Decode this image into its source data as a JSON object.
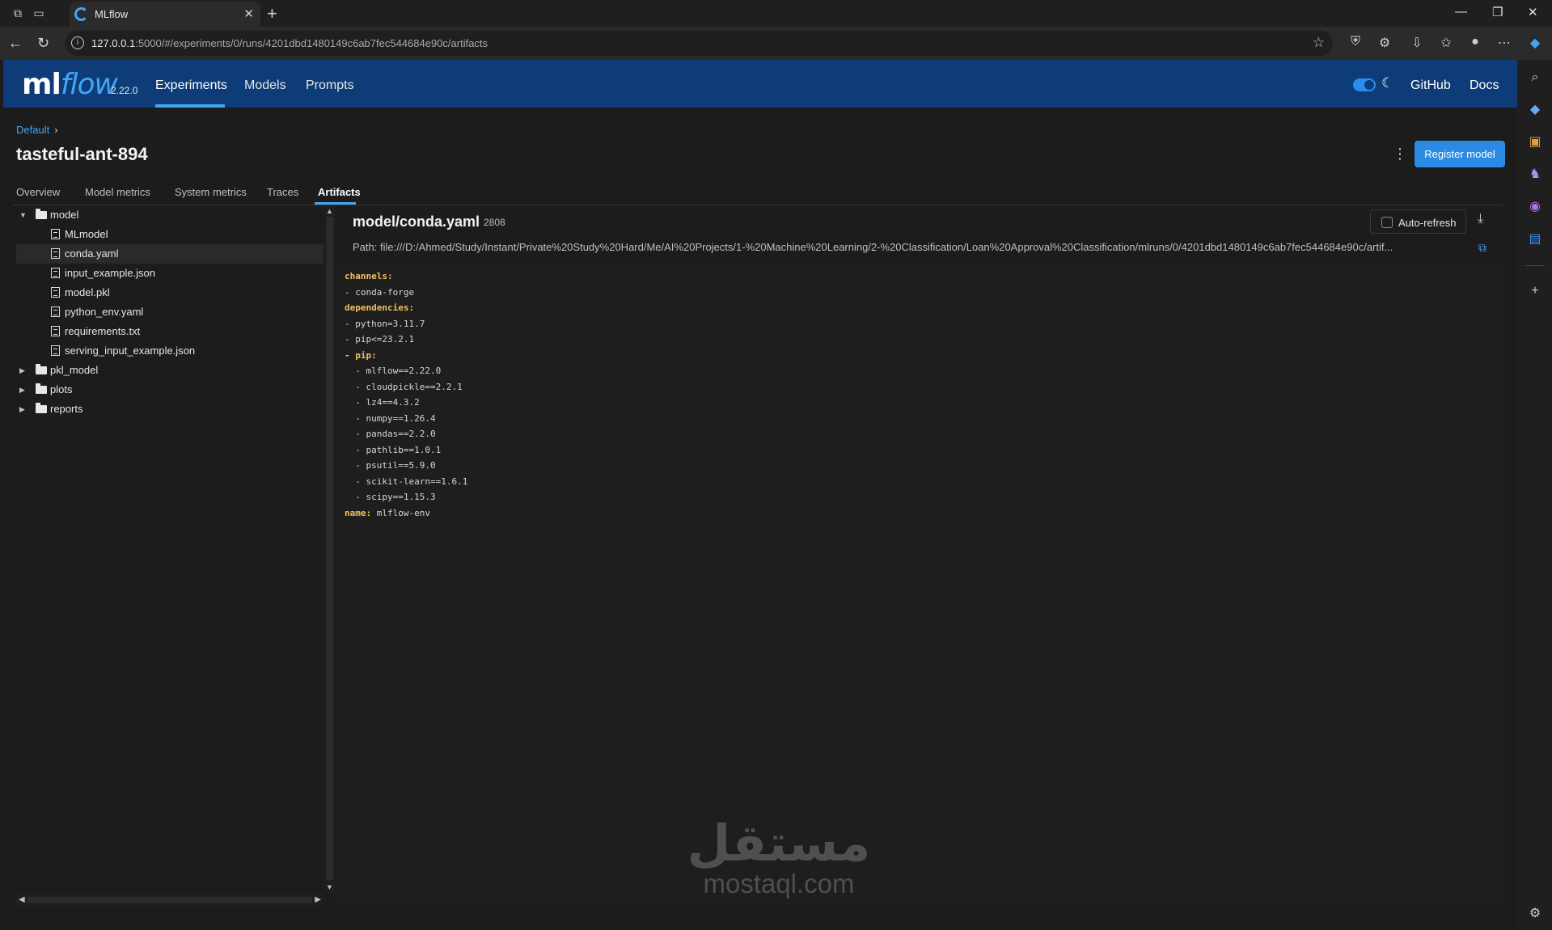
{
  "browser": {
    "tab_title": "MLflow",
    "url_host": "127.0.0.1",
    "url_rest": ":5000/#/experiments/0/runs/4201dbd1480149c6ab7fec544684e90c/artifacts",
    "newtab_label": "+",
    "icons": [
      "workspaces-icon",
      "tab-actions-icon",
      "back-icon",
      "refresh-icon",
      "star-icon",
      "shield-extension-icon",
      "extensions-icon",
      "downloads-icon",
      "favorites-icon",
      "profile-avatar",
      "more-icon",
      "copilot-icon"
    ]
  },
  "edge_sidebar": {
    "icons": [
      "search-icon",
      "tag-icon",
      "toolbox-icon",
      "chess-icon",
      "copilot-icon",
      "outlook-icon",
      "add-icon",
      "settings-icon"
    ]
  },
  "header": {
    "logo_ml": "ml",
    "logo_flow": "flow",
    "version": "2.22.0",
    "nav": [
      "Experiments",
      "Models",
      "Prompts"
    ],
    "active_nav": "Experiments",
    "github": "GitHub",
    "docs": "Docs",
    "accent": "#43a5f5",
    "bar_color": "#0e3c78"
  },
  "run": {
    "breadcrumb": "Default",
    "title": "tasteful-ant-894",
    "register_button": "Register model",
    "tabs": [
      "Overview",
      "Model metrics",
      "System metrics",
      "Traces",
      "Artifacts"
    ],
    "active_tab": "Artifacts"
  },
  "tree": {
    "items": [
      {
        "label": "model",
        "type": "folder",
        "expanded": true
      },
      {
        "label": "MLmodel",
        "type": "file"
      },
      {
        "label": "conda.yaml",
        "type": "file",
        "selected": true
      },
      {
        "label": "input_example.json",
        "type": "file"
      },
      {
        "label": "model.pkl",
        "type": "file"
      },
      {
        "label": "python_env.yaml",
        "type": "file"
      },
      {
        "label": "requirements.txt",
        "type": "file"
      },
      {
        "label": "serving_input_example.json",
        "type": "file"
      },
      {
        "label": "pkl_model",
        "type": "folder",
        "expanded": false
      },
      {
        "label": "plots",
        "type": "folder",
        "expanded": false
      },
      {
        "label": "reports",
        "type": "folder",
        "expanded": false
      }
    ]
  },
  "viewer": {
    "file_title": "model/conda.yaml",
    "file_size": "2808",
    "auto_refresh": "Auto-refresh",
    "path": "Path: file:///D:/Ahmed/Study/Instant/Private%20Study%20Hard/Me/AI%20Projects/1-%20Machine%20Learning/2-%20Classification/Loan%20Approval%20Classification/mlruns/0/4201dbd1480149c6ab7fec544684e90c/artif...",
    "code": [
      {
        "key": "channels:",
        "rest": ""
      },
      {
        "key": "",
        "rest": "- conda-forge"
      },
      {
        "key": "dependencies:",
        "rest": ""
      },
      {
        "key": "",
        "rest": "- python=3.11.7"
      },
      {
        "key": "",
        "rest": "- pip<=23.2.1"
      },
      {
        "key": "- pip:",
        "rest": ""
      },
      {
        "key": "",
        "rest": "  - mlflow==2.22.0"
      },
      {
        "key": "",
        "rest": "  - cloudpickle==2.2.1"
      },
      {
        "key": "",
        "rest": "  - lz4==4.3.2"
      },
      {
        "key": "",
        "rest": "  - numpy==1.26.4"
      },
      {
        "key": "",
        "rest": "  - pandas==2.2.0"
      },
      {
        "key": "",
        "rest": "  - pathlib==1.0.1"
      },
      {
        "key": "",
        "rest": "  - psutil==5.9.0"
      },
      {
        "key": "",
        "rest": "  - scikit-learn==1.6.1"
      },
      {
        "key": "",
        "rest": "  - scipy==1.15.3"
      },
      {
        "key": "name:",
        "rest": " mlflow-env"
      }
    ]
  },
  "watermark": {
    "arabic": "مستقل",
    "latin": "mostaql.com"
  }
}
